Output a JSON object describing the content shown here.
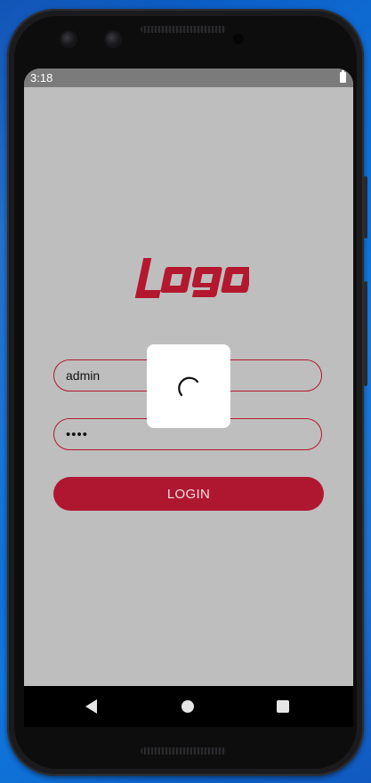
{
  "status_bar": {
    "time": "3:18",
    "battery_icon": "battery-full-icon"
  },
  "app": {
    "logo_text": "logo",
    "brand_color": "#af1730",
    "background_color": "#bebebe"
  },
  "login_form": {
    "username_value": "admin",
    "password_value": "••••",
    "login_label": "LOGIN"
  },
  "loading_dialog": {
    "spinner_icon": "loading-spinner-icon"
  },
  "nav_bar": {
    "back_icon": "back-triangle-icon",
    "home_icon": "home-circle-icon",
    "recents_icon": "recents-square-icon"
  }
}
